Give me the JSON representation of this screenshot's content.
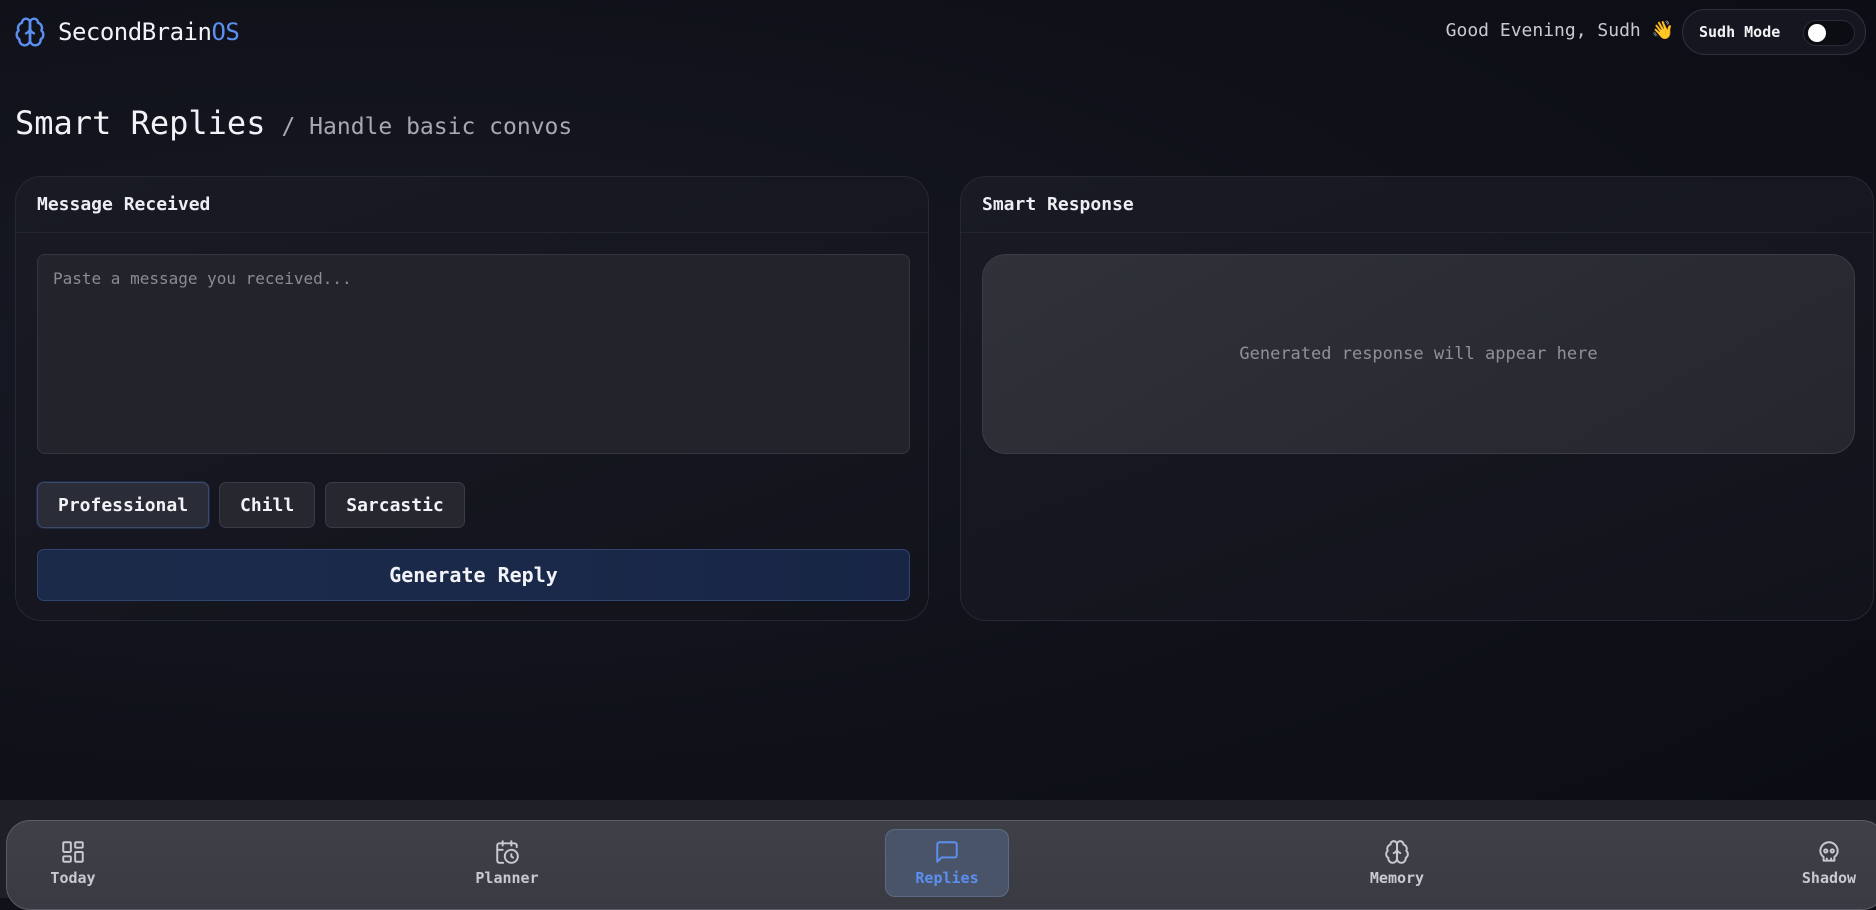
{
  "header": {
    "brand_main": "SecondBrain",
    "brand_accent": "OS",
    "greeting": "Good Evening, Sudh 👋",
    "mode_label": "Sudh Mode",
    "mode_on": false
  },
  "page": {
    "title": "Smart Replies",
    "subtitle": "/ Handle basic convos"
  },
  "left_card": {
    "title": "Message Received",
    "input_value": "",
    "input_placeholder": "Paste a message you received...",
    "tones": [
      {
        "label": "Professional",
        "selected": true
      },
      {
        "label": "Chill",
        "selected": false
      },
      {
        "label": "Sarcastic",
        "selected": false
      }
    ],
    "generate_label": "Generate Reply"
  },
  "right_card": {
    "title": "Smart Response",
    "placeholder": "Generated response will appear here"
  },
  "nav": {
    "items": [
      {
        "label": "Today",
        "icon": "grid-icon",
        "active": false
      },
      {
        "label": "Planner",
        "icon": "calendar-clock-icon",
        "active": false
      },
      {
        "label": "Replies",
        "icon": "message-icon",
        "active": true
      },
      {
        "label": "Memory",
        "icon": "brain-icon",
        "active": false
      },
      {
        "label": "Shadow",
        "icon": "skull-icon",
        "active": false
      }
    ]
  },
  "colors": {
    "accent": "#5b8ff0",
    "background": "#101119",
    "generate_button": "#1c2a4a"
  }
}
